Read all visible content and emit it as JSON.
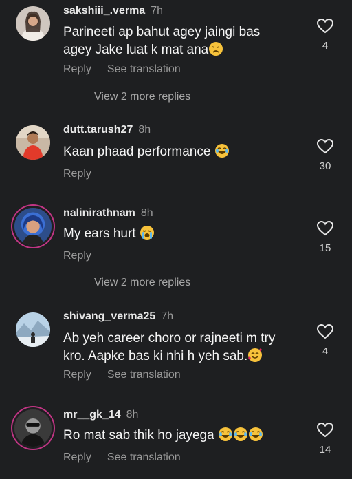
{
  "comments": [
    {
      "username": "sakshiii_.verma",
      "time": "7h",
      "text_line1": "Parineeti ap bahut agey jaingi bas",
      "text_line2": "agey Jake luat k mat ana",
      "emoji": "disappointed",
      "reply": "Reply",
      "translate": "See translation",
      "likes": "4"
    },
    {
      "username": "dutt.tarush27",
      "time": "8h",
      "text_line1": "Kaan phaad performance",
      "text_line2": "",
      "emoji": "laughing",
      "reply": "Reply",
      "translate": "",
      "likes": "30"
    },
    {
      "username": "nalinirathnam",
      "time": "8h",
      "text_line1": "My ears hurt",
      "text_line2": "",
      "emoji": "crying",
      "reply": "Reply",
      "translate": "",
      "likes": "15"
    },
    {
      "username": "shivang_verma25",
      "time": "7h",
      "text_line1": "Ab yeh career choro or rajneeti m try",
      "text_line2": "kro. Aapke bas ki nhi h yeh sab.",
      "emoji": "smiling-hearts",
      "reply": "Reply",
      "translate": "See translation",
      "likes": "4"
    },
    {
      "username": "mr__gk_14",
      "time": "8h",
      "text_line1": "Ro mat sab thik ho jayega",
      "text_line2": "",
      "emoji": "laughing x3",
      "reply": "Reply",
      "translate": "See translation",
      "likes": "14"
    }
  ],
  "view_more_1": "View 2 more replies",
  "view_more_2": "View 2 more replies",
  "icons": {
    "like": "heart-outline-icon"
  },
  "colors": {
    "background": "#1e1f21",
    "text": "#f5f5f5",
    "muted": "#9a9a9a",
    "story_ring": "#c13584"
  }
}
